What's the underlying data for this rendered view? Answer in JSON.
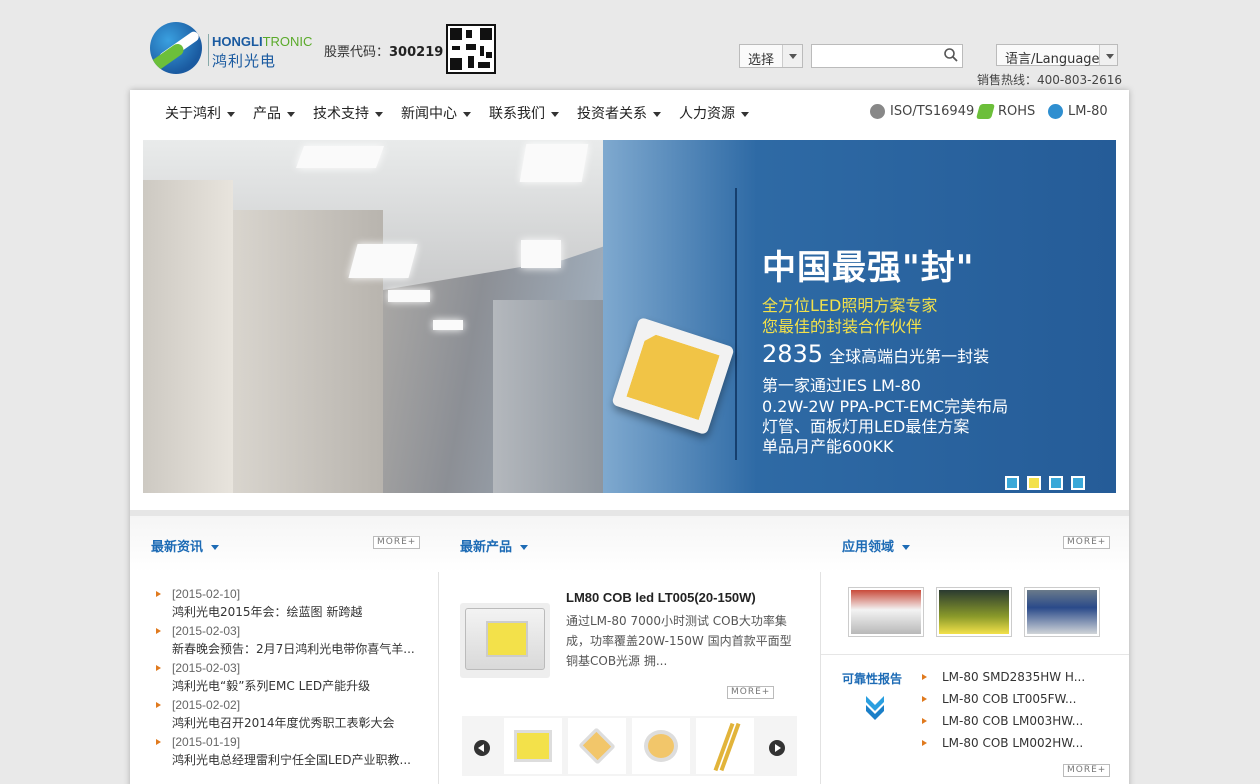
{
  "header": {
    "logo_en_1": "HONGLI",
    "logo_en_2": "TRONIC",
    "logo_cn": "鸿利光电",
    "stock_label": "股票代码：",
    "stock_code": "300219",
    "select_label": "选择",
    "search_placeholder": "",
    "language_label": "语言/Language",
    "hotline": "销售热线：400-803-2616"
  },
  "nav": {
    "items": [
      "关于鸿利",
      "产品",
      "技术支持",
      "新闻中心",
      "联系我们",
      "投资者关系",
      "人力资源"
    ],
    "certs": [
      "ISO/TS16949",
      "ROHS",
      "LM-80"
    ]
  },
  "banner": {
    "title": "中国最强\"封\"",
    "sub1": "全方位LED照明方案专家",
    "sub2": "您最佳的封装合作伙伴",
    "line1_big": "2835",
    "line1": "全球高端白光第一封装",
    "line2": "第一家通过IES LM-80",
    "line3": "0.2W-2W PPA-PCT-EMC完美布局",
    "line4": "灯管、面板灯用LED最佳方案",
    "line5": "单品月产能600KK",
    "active_dot": 2,
    "dot_count": 4
  },
  "sections": {
    "news_title": "最新资讯",
    "products_title": "最新产品",
    "apps_title": "应用领域",
    "more": "MORE+"
  },
  "news": [
    {
      "date": "[2015-02-10]",
      "title": "鸿利光电2015年会：绘蓝图 新跨越"
    },
    {
      "date": "[2015-02-03]",
      "title": "新春晚会预告：2月7日鸿利光电带你喜气羊..."
    },
    {
      "date": "[2015-02-03]",
      "title": "鸿利光电“毅”系列EMC LED产能升级"
    },
    {
      "date": "[2015-02-02]",
      "title": "鸿利光电召开2014年度优秀职工表彰大会"
    },
    {
      "date": "[2015-01-19]",
      "title": "鸿利光电总经理雷利宁任全国LED产业职教..."
    }
  ],
  "product": {
    "name": "LM80 COB led LT005(20-150W)",
    "desc": "通过LM-80 7000小时测试 COB大功率集成，功率覆盖20W-150W 国内首款平面型铜基COB光源 拥..."
  },
  "reliability": {
    "title": "可靠性报告",
    "items": [
      "LM-80 SMD2835HW H...",
      "LM-80 COB LT005FW...",
      "LM-80 COB LM003HW...",
      "LM-80 COB LM002HW..."
    ]
  },
  "colors": {
    "accent": "#1d6bb5",
    "bullet": "#e07a1e",
    "banner_yellow": "#f3e14a"
  }
}
